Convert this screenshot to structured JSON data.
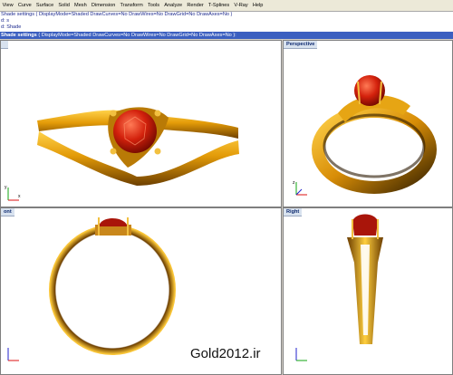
{
  "menu": [
    "View",
    "Curve",
    "Surface",
    "Solid",
    "Mesh",
    "Dimension",
    "Transform",
    "Tools",
    "Analyze",
    "Render",
    "T-Splines",
    "V-Ray",
    "Help"
  ],
  "command_history": [
    "Shade settings ( DisplayMode=Shaded  DrawCurves=No  DrawWires=No  DrawGrid=No  DrawAxes=No )",
    "d: s",
    "d: Shade"
  ],
  "command_line": {
    "prefix": "Shade settings",
    "text": " ( DisplayMode=Shaded  DrawCurves=No  DrawWires=No  DrawGrid=No  DrawAxes=No ):"
  },
  "viewports": {
    "top": {
      "title": ""
    },
    "perspective": {
      "title": "Perspective"
    },
    "front": {
      "title": "ont"
    },
    "right": {
      "title": "Right"
    }
  },
  "axes": {
    "x": "x",
    "y": "y",
    "z": "z"
  },
  "watermark": "Gold2012.ir",
  "colors": {
    "gold": "#e8a50c",
    "gold_dark": "#7a4a00",
    "gem": "#d0210e",
    "viewport_bg": "#ffffff",
    "cmdline_bg": "#3b5fc0"
  }
}
